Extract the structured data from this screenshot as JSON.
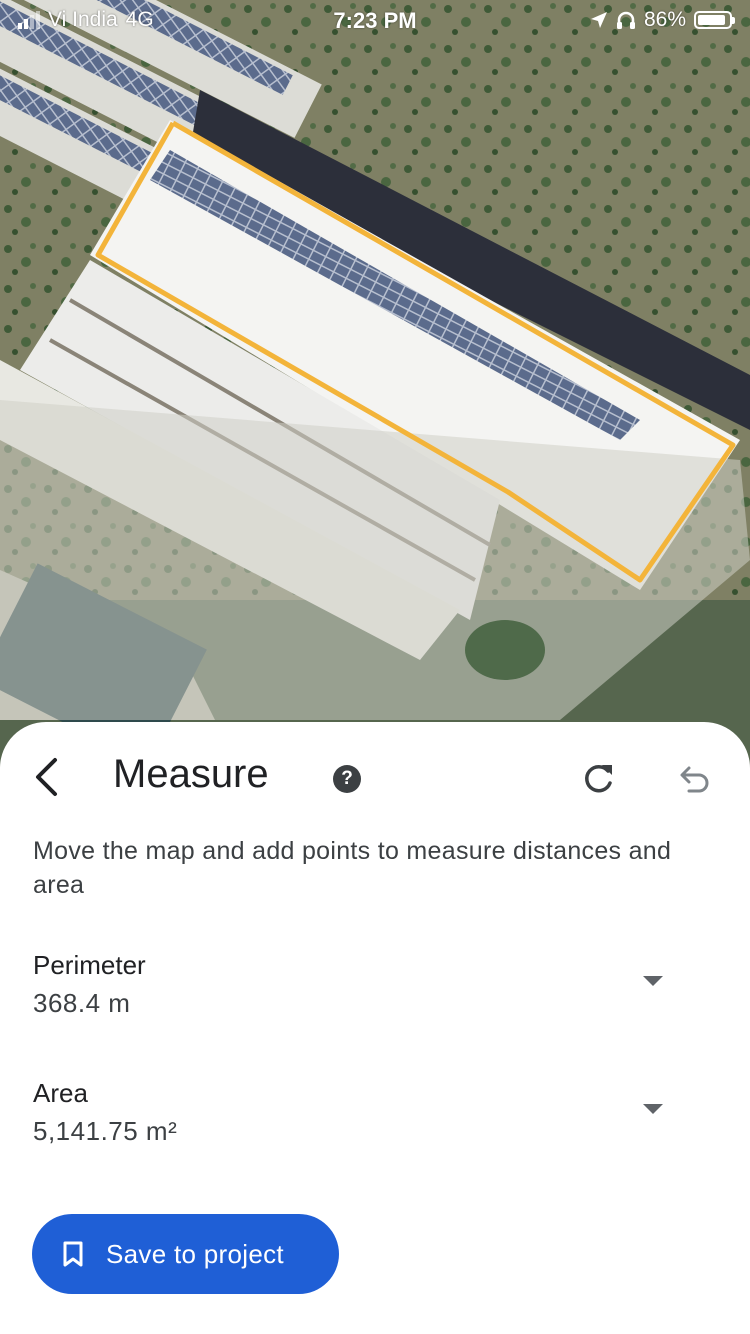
{
  "status_bar": {
    "carrier": "Vi India",
    "network": "4G",
    "time": "7:23 PM",
    "battery": "86%"
  },
  "map": {
    "outline_color": "#f3b43a",
    "view": "satellite"
  },
  "sheet": {
    "title": "Measure",
    "help_icon": "help-circle-icon",
    "instructions": "Move the map and add points to measure distances and area",
    "perimeter": {
      "label": "Perimeter",
      "value": "368.4 m"
    },
    "area": {
      "label": "Area",
      "value": "5,141.75 m²"
    },
    "save_button_label": "Save to project"
  },
  "colors": {
    "accent": "#1f5fd6",
    "outline": "#f3b43a"
  }
}
